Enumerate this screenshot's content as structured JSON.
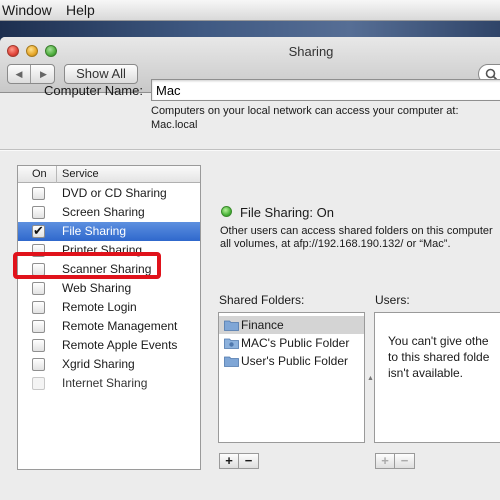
{
  "menubar": {
    "items": [
      "Window",
      "Help"
    ]
  },
  "window": {
    "title": "Sharing"
  },
  "toolbar": {
    "show_all": "Show All"
  },
  "computer_name": {
    "label": "Computer Name:",
    "value": "Mac",
    "desc_line1": "Computers on your local network can access your computer at:",
    "desc_line2": "Mac.local"
  },
  "services": {
    "header_on": "On",
    "header_service": "Service",
    "selected": "File Sharing",
    "items": [
      {
        "label": "DVD or CD Sharing",
        "checked": false
      },
      {
        "label": "Screen Sharing",
        "checked": false
      },
      {
        "label": "File Sharing",
        "checked": true
      },
      {
        "label": "Printer Sharing",
        "checked": false
      },
      {
        "label": "Scanner Sharing",
        "checked": false
      },
      {
        "label": "Web Sharing",
        "checked": false
      },
      {
        "label": "Remote Login",
        "checked": false
      },
      {
        "label": "Remote Management",
        "checked": false
      },
      {
        "label": "Remote Apple Events",
        "checked": false
      },
      {
        "label": "Xgrid Sharing",
        "checked": false
      },
      {
        "label": "Internet Sharing",
        "checked": false,
        "disabled": true
      }
    ]
  },
  "status": {
    "text": "File Sharing: On",
    "color": "#4ab53a",
    "desc_line1": "Other users can access shared folders on this computer",
    "desc_line2": "all volumes, at afp://192.168.190.132/ or “Mac”."
  },
  "shared_folders": {
    "label": "Shared Folders:",
    "items": [
      {
        "name": "Finance",
        "icon": "folder-icon",
        "selected": true
      },
      {
        "name": "MAC's Public Folder",
        "icon": "public-folder-icon"
      },
      {
        "name": "User's Public Folder",
        "icon": "folder-icon"
      }
    ],
    "add": "+",
    "remove": "−"
  },
  "users": {
    "label": "Users:",
    "message": "You can't give othe\nto this shared folde\nisn't available.",
    "add": "+",
    "remove": "−"
  },
  "highlight_color": "#e0121b"
}
